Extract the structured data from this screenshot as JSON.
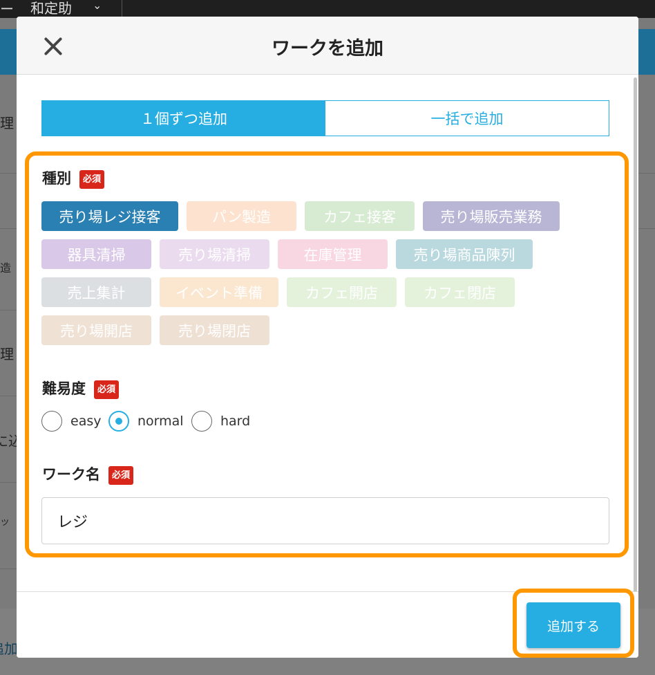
{
  "background": {
    "dash": "ー",
    "user_name": "和定助",
    "chevron": "⌄",
    "edge_chars": [
      "理",
      "造",
      "理",
      "に込",
      "ッ"
    ],
    "footer_text": "追加"
  },
  "modal": {
    "title": "ワークを追加",
    "close_icon": "close-icon"
  },
  "tabs": [
    {
      "label": "１個ずつ追加",
      "active": true
    },
    {
      "label": "一括で追加",
      "active": false
    }
  ],
  "type_field": {
    "label": "種別",
    "required_badge": "必須",
    "chips": [
      {
        "label": "売り場レジ接客",
        "color": "#2a7fb3",
        "selected": true
      },
      {
        "label": "パン製造",
        "color": "#fde3cf"
      },
      {
        "label": "カフェ接客",
        "color": "#d6ebd2"
      },
      {
        "label": "売り場販売業務",
        "color": "#b9b6d5"
      },
      {
        "label": "器具清掃",
        "color": "#d9c8e7"
      },
      {
        "label": "売り場清掃",
        "color": "#eadcee"
      },
      {
        "label": "在庫管理",
        "color": "#f9d7e2"
      },
      {
        "label": "売り場商品陳列",
        "color": "#b9d9df"
      },
      {
        "label": "売上集計",
        "color": "#dcdfe1"
      },
      {
        "label": "イベント準備",
        "color": "#fbe7d0"
      },
      {
        "label": "カフェ開店",
        "color": "#e4f2dc"
      },
      {
        "label": "カフェ閉店",
        "color": "#e4f2dc"
      },
      {
        "label": "売り場開店",
        "color": "#f0e1d5"
      },
      {
        "label": "売り場閉店",
        "color": "#efe0d4"
      }
    ]
  },
  "difficulty_field": {
    "label": "難易度",
    "required_badge": "必須",
    "options": [
      {
        "label": "easy",
        "checked": false
      },
      {
        "label": "normal",
        "checked": true
      },
      {
        "label": "hard",
        "checked": false
      }
    ]
  },
  "name_field": {
    "label": "ワーク名",
    "required_badge": "必須",
    "value": "レジ"
  },
  "footer": {
    "add_label": "追加する"
  }
}
